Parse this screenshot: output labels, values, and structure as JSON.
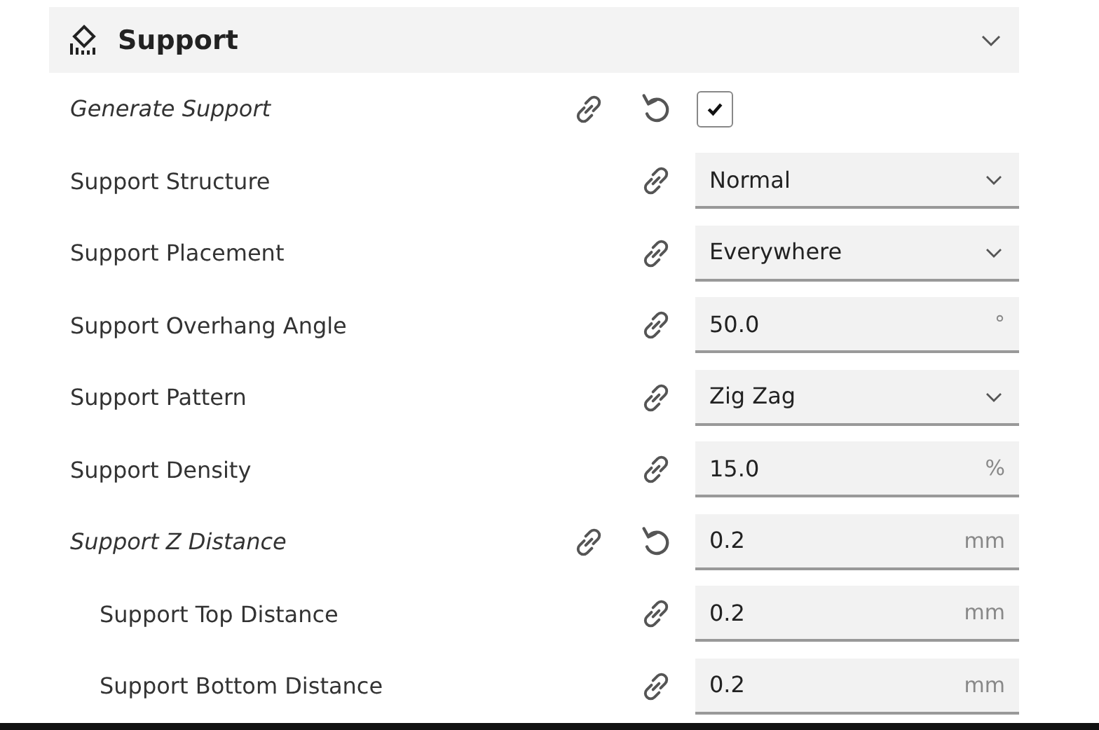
{
  "section": {
    "title": "Support",
    "expanded": true
  },
  "settings": [
    {
      "label": "Generate Support",
      "kind": "checkbox",
      "modified": true,
      "checked": true
    },
    {
      "label": "Support Structure",
      "kind": "dropdown",
      "modified": false,
      "value": "Normal"
    },
    {
      "label": "Support Placement",
      "kind": "dropdown",
      "modified": false,
      "value": "Everywhere"
    },
    {
      "label": "Support Overhang Angle",
      "kind": "number",
      "modified": false,
      "value": "50.0",
      "unit": "°"
    },
    {
      "label": "Support Pattern",
      "kind": "dropdown",
      "modified": false,
      "value": "Zig Zag"
    },
    {
      "label": "Support Density",
      "kind": "number",
      "modified": false,
      "value": "15.0",
      "unit": "%"
    },
    {
      "label": "Support Z Distance",
      "kind": "number",
      "modified": true,
      "value": "0.2",
      "unit": "mm",
      "children": [
        {
          "label": "Support Top Distance",
          "kind": "number",
          "modified": false,
          "value": "0.2",
          "unit": "mm"
        },
        {
          "label": "Support Bottom Distance",
          "kind": "number",
          "modified": false,
          "value": "0.2",
          "unit": "mm"
        }
      ]
    }
  ]
}
